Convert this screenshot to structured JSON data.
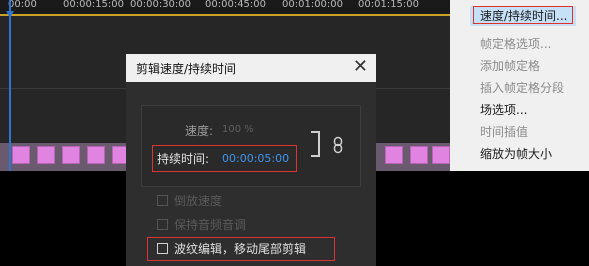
{
  "timeline": {
    "ruler_labels": [
      "00:00",
      "00:00:15:00",
      "00:00:30:00",
      "00:00:45:00",
      "00:01:00:00",
      "00:01:15:00"
    ]
  },
  "context_menu": {
    "items": [
      {
        "label": "速度/持续时间...",
        "state": "highlighted"
      },
      {
        "label": "帧定格选项...",
        "state": "disabled"
      },
      {
        "label": "添加帧定格",
        "state": "disabled"
      },
      {
        "label": "插入帧定格分段",
        "state": "disabled"
      },
      {
        "label": "场选项...",
        "state": "enabled"
      },
      {
        "label": "时间插值",
        "state": "disabled"
      },
      {
        "label": "缩放为帧大小",
        "state": "enabled"
      }
    ]
  },
  "dialog": {
    "title": "剪辑速度/持续时间",
    "close_glyph": "✕",
    "speed_label": "速度:",
    "speed_value": "100 %",
    "duration_label": "持续时间:",
    "duration_value": "00:00:05:00",
    "reverse_label": "倒放速度",
    "keep_pitch_label": "保持音频音调",
    "ripple_label": "波纹编辑，移动尾部剪辑"
  },
  "icons": {
    "link": "link-icon",
    "close": "close-icon"
  },
  "colors": {
    "highlight_outline": "#e0302a",
    "timecode_blue": "#3d95f0",
    "clip_frame": "#e184e1",
    "playhead": "#2f74d0"
  }
}
